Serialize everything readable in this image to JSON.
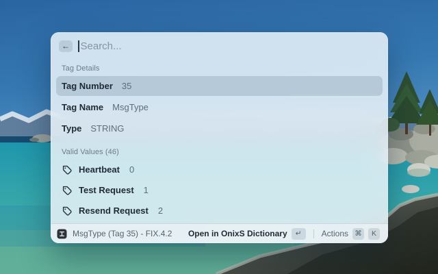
{
  "search": {
    "placeholder": "Search...",
    "back_icon": "←"
  },
  "sections": {
    "details": {
      "title": "Tag Details",
      "rows": [
        {
          "label": "Tag Number",
          "value": "35"
        },
        {
          "label": "Tag Name",
          "value": "MsgType"
        },
        {
          "label": "Type",
          "value": "STRING"
        }
      ]
    },
    "valid_values": {
      "title": "Valid Values (46)",
      "items": [
        {
          "label": "Heartbeat",
          "value": "0"
        },
        {
          "label": "Test Request",
          "value": "1"
        },
        {
          "label": "Resend Request",
          "value": "2"
        }
      ]
    }
  },
  "footer": {
    "title": "MsgType (Tag 35) - FIX.4.2",
    "primary_action_label": "Open in OnixS Dictionary",
    "primary_key": "↵",
    "actions_label": "Actions",
    "cmd_key": "⌘",
    "k_key": "K"
  },
  "colors": {
    "sky": "#2e6fa9",
    "water_turquoise": "#2ba3b2",
    "shallow_green": "#67af97",
    "rock_dark": "#2a2e28",
    "panel_tint": "#e8f0f6",
    "selected_row": "rgba(128,154,173,0.35)"
  }
}
